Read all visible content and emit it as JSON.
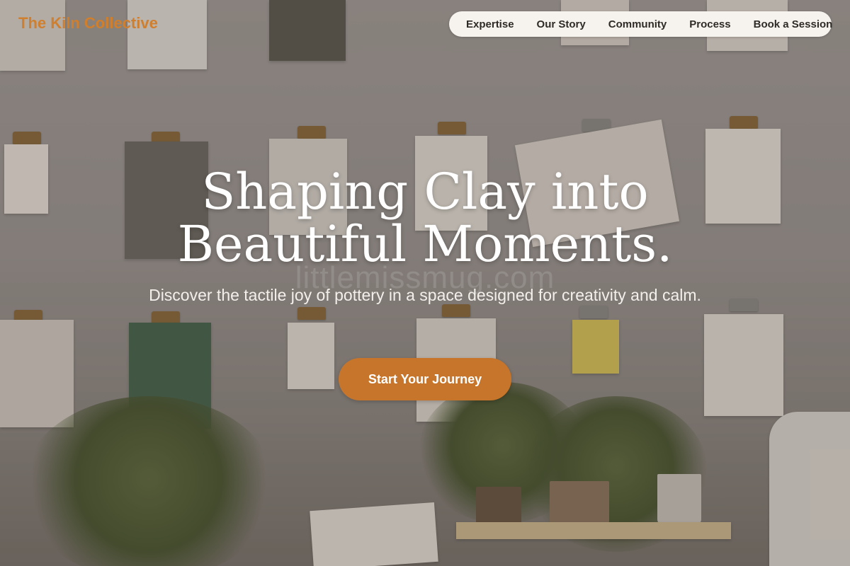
{
  "brand": {
    "name": "The Kiln Collective",
    "accent_color": "#cf7f2d"
  },
  "nav": {
    "items": [
      {
        "label": "Expertise"
      },
      {
        "label": "Our Story"
      },
      {
        "label": "Community"
      },
      {
        "label": "Process"
      },
      {
        "label": "Book a Session"
      }
    ]
  },
  "hero": {
    "headline_line1": "Shaping Clay into",
    "headline_line2": "Beautiful Moments.",
    "subtitle": "Discover the tactile joy of pottery in a space designed for creativity and calm.",
    "cta_label": "Start Your Journey",
    "cta_color": "#c7752b",
    "background_watermark": "littlemissmug.com"
  }
}
